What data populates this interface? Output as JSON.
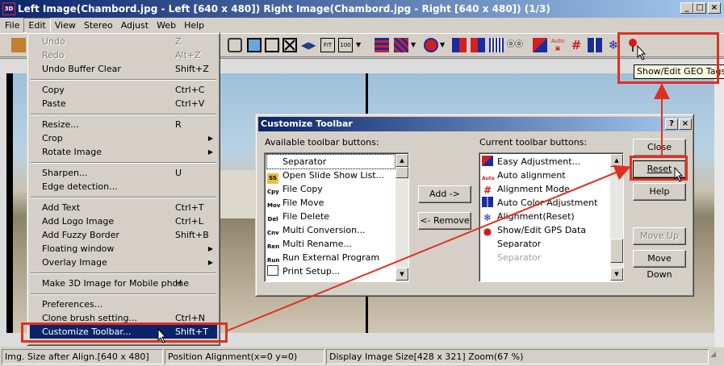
{
  "window": {
    "title": "Left Image(Chambord.jpg - Left [640 x 480]) Right Image(Chambord.jpg - Right [640 x 480])  (1/3)",
    "app_icon": "3D",
    "controls": [
      "minimize-icon",
      "maximize-icon",
      "close-icon"
    ]
  },
  "menubar": [
    "File",
    "Edit",
    "View",
    "Stereo",
    "Adjust",
    "Web",
    "Help"
  ],
  "edit_menu": {
    "items": [
      {
        "label": "Undo",
        "shortcut": "Z",
        "disabled": true
      },
      {
        "label": "Redo",
        "shortcut": "Alt+Z",
        "disabled": true
      },
      {
        "label": "Undo Buffer Clear",
        "shortcut": "Shift+Z"
      },
      {
        "label": "Copy",
        "shortcut": "Ctrl+C"
      },
      {
        "label": "Paste",
        "shortcut": "Ctrl+V"
      },
      {
        "label": "Resize...",
        "shortcut": "R"
      },
      {
        "label": "Crop",
        "shortcut": "",
        "submenu": true
      },
      {
        "label": "Rotate Image",
        "shortcut": "",
        "submenu": true
      },
      {
        "label": "Sharpen...",
        "shortcut": "U"
      },
      {
        "label": "Edge detection...",
        "shortcut": ""
      },
      {
        "label": "Add Text",
        "shortcut": "Ctrl+T"
      },
      {
        "label": "Add Logo Image",
        "shortcut": "Ctrl+L"
      },
      {
        "label": "Add Fuzzy Border",
        "shortcut": "Shift+B"
      },
      {
        "label": "Floating window",
        "shortcut": "",
        "submenu": true
      },
      {
        "label": "Overlay Image",
        "shortcut": "",
        "submenu": true
      },
      {
        "label": "Make 3D Image for Mobile phone",
        "shortcut": "H"
      },
      {
        "label": "Preferences...",
        "shortcut": ""
      },
      {
        "label": "Clone brush setting...",
        "shortcut": "Ctrl+N"
      },
      {
        "label": "Customize Toolbar...",
        "shortcut": "Shift+T",
        "selected": true
      }
    ]
  },
  "dialog": {
    "title": "Customize Toolbar",
    "title_buttons": [
      "?",
      "×"
    ],
    "available_label": "Available toolbar buttons:",
    "current_label": "Current toolbar buttons:",
    "available_items": [
      {
        "label": "Separator",
        "icon": ""
      },
      {
        "label": "Open Slide Show List...",
        "icon": "SS"
      },
      {
        "label": "File Copy",
        "icon": "Cpy"
      },
      {
        "label": "File Move",
        "icon": "Mov"
      },
      {
        "label": "File Delete",
        "icon": "Del"
      },
      {
        "label": "Multi Conversion...",
        "icon": "Cnv"
      },
      {
        "label": "Multi Rename...",
        "icon": "Ren"
      },
      {
        "label": "Run External Program",
        "icon": "Run"
      },
      {
        "label": "Print Setup...",
        "icon": ""
      }
    ],
    "current_items": [
      {
        "label": "Easy Adjustment...",
        "icon": "easy-adjust-icon",
        "disabled": false
      },
      {
        "label": "Auto alignment",
        "icon": "auto-align-icon",
        "disabled": false
      },
      {
        "label": "Alignment Mode",
        "icon": "alignment-mode-icon",
        "disabled": false
      },
      {
        "label": "Auto Color Adjustment",
        "icon": "auto-color-icon",
        "disabled": false
      },
      {
        "label": "Alignment(Reset)",
        "icon": "alignment-reset-icon",
        "disabled": false
      },
      {
        "label": "Show/Edit GPS Data",
        "icon": "gps-pin-icon",
        "disabled": false
      },
      {
        "label": "Separator",
        "icon": "",
        "disabled": false
      },
      {
        "label": "Separator",
        "icon": "",
        "disabled": true
      }
    ],
    "buttons": {
      "add": "Add ->",
      "remove": "<- Remove",
      "close": "Close",
      "reset": "Reset",
      "help": "Help",
      "move_up": "Move Up",
      "move_down": "Move Down"
    }
  },
  "tooltip": "Show/Edit GEO Tags",
  "statusbar": [
    "Img. Size after Align.[640 x 480]",
    "Position Alignment(x=0 y=0)",
    "Display Image Size[428 x 321]  Zoom(67 %)"
  ],
  "colors": {
    "title_gradient_start": "#0a246a",
    "highlight_red": "#e03020"
  }
}
